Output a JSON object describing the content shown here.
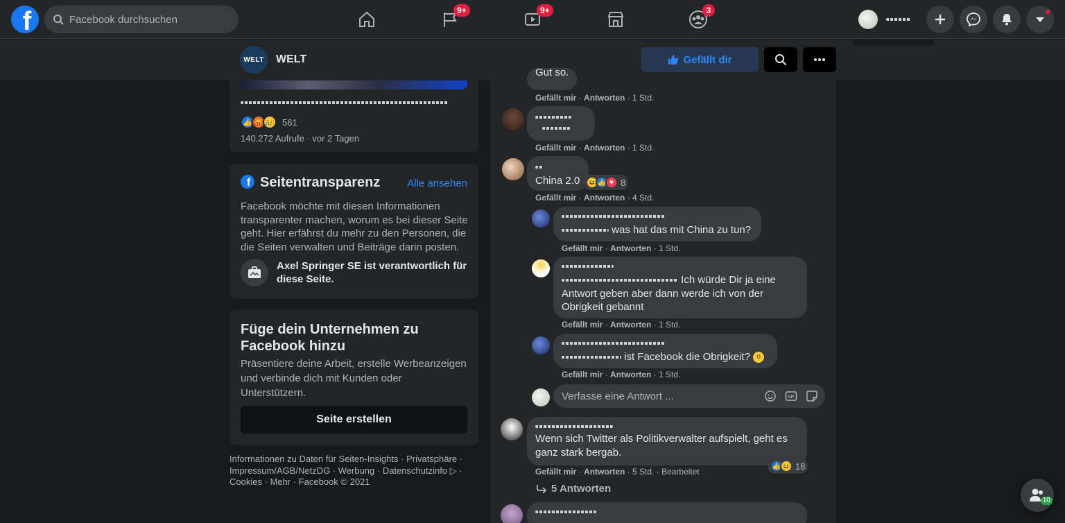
{
  "topbar": {
    "search_placeholder": "Facebook durchsuchen",
    "nav": [
      {
        "icon": "home-icon",
        "badge": ""
      },
      {
        "icon": "flag-icon",
        "badge": "9+"
      },
      {
        "icon": "watch-icon",
        "badge": "9+"
      },
      {
        "icon": "marketplace-icon",
        "badge": ""
      },
      {
        "icon": "groups-icon",
        "badge": "3"
      }
    ],
    "accent": "#1877f2",
    "badge_color": "#e41e3f"
  },
  "page_header": {
    "logo_text": "WELT",
    "page_name": "WELT",
    "like_label": "Gefällt dir"
  },
  "video_card": {
    "reaction_count": "561",
    "meta": "140.272 Aufrufe · vor 2 Tagen"
  },
  "transparency": {
    "title": "Seitentransparenz",
    "see_all": "Alle ansehen",
    "description": "Facebook möchte mit diesen Informationen transparenter machen, worum es bei dieser Seite geht. Hier erfährst du mehr zu den Personen, die die Seiten verwalten und Beiträge darin posten.",
    "responsible": "Axel Springer SE ist verantwortlich für diese Seite."
  },
  "business": {
    "title": "Füge dein Unternehmen zu Facebook hinzu",
    "description": "Präsentiere deine Arbeit, erstelle Werbeanzeigen und verbinde dich mit Kunden oder Unterstützern.",
    "create_label": "Seite erstellen"
  },
  "footer": {
    "text": "Informationen zu Daten für Seiten-Insights · Privatsphäre · Impressum/AGB/NetzDG · Werbung · Datenschutzinfo ▷ · Cookies · Mehr · Facebook © 2021"
  },
  "comments": {
    "like": "Gefällt mir",
    "reply": "Antworten",
    "c0": {
      "text": "Gut so.",
      "time": "1 Std."
    },
    "c1": {
      "time": "1 Std."
    },
    "c2": {
      "text": "China 2.0",
      "reactions": "8",
      "time": "4 Std."
    },
    "c3": {
      "text": "was hat das mit China zu tun?",
      "time": "1 Std."
    },
    "c4": {
      "text": "Ich würde Dir ja eine Antwort geben aber dann werde ich von der Obrigkeit gebannt",
      "time": "1 Std."
    },
    "c5": {
      "text": "ist Facebook die Obrigkeit?",
      "time": "1 Std."
    },
    "reply_placeholder": "Verfasse eine Antwort ...",
    "c6": {
      "text": "Wenn sich Twitter als Politikverwalter aufspielt, geht es ganz stark bergab.",
      "reactions": "18",
      "time": "5 Std.",
      "edited": "Bearbeitet"
    },
    "replies_link": "5 Antworten"
  },
  "contacts_badge": "10"
}
